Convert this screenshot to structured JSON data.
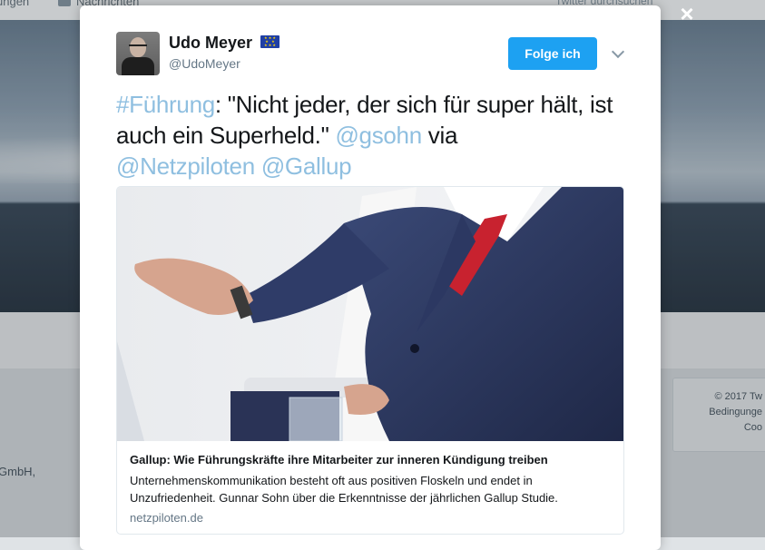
{
  "background": {
    "nav_left": "ungen",
    "nav_messages": "Nachrichten",
    "search_placeholder": "Twitter durchsuchen",
    "footer_lines": [
      "© 2017 Tw",
      "Bedingunge",
      "Coo"
    ],
    "company_fragment": "GmbH,"
  },
  "modal": {
    "close_label": "×",
    "author": {
      "name": "Udo Meyer",
      "handle": "@UdoMeyer"
    },
    "follow_button": "Folge ich",
    "tweet": {
      "hashtag": "#Führung",
      "text_1": ": \"Nicht jeder, der sich für super hält, ist auch ein Superheld.\" ",
      "mention_1": "@gsohn",
      "text_2": " via ",
      "mention_2": "@Netzpiloten",
      "mention_3": "@Gallup"
    },
    "card": {
      "title": "Gallup: Wie Führungskräfte ihre Mitarbeiter zur inneren Kündigung treiben",
      "description": "Unternehmenskommunikation besteht oft aus positiven Floskeln und endet in Unzufriedenheit. Gunnar Sohn über die Erkenntnisse der jährlichen Gallup Studie.",
      "domain": "netzpiloten.de"
    }
  },
  "colors": {
    "link": "#8fbfe0",
    "follow_button": "#1da1f2",
    "eu_flag": "#1f3fa5"
  }
}
